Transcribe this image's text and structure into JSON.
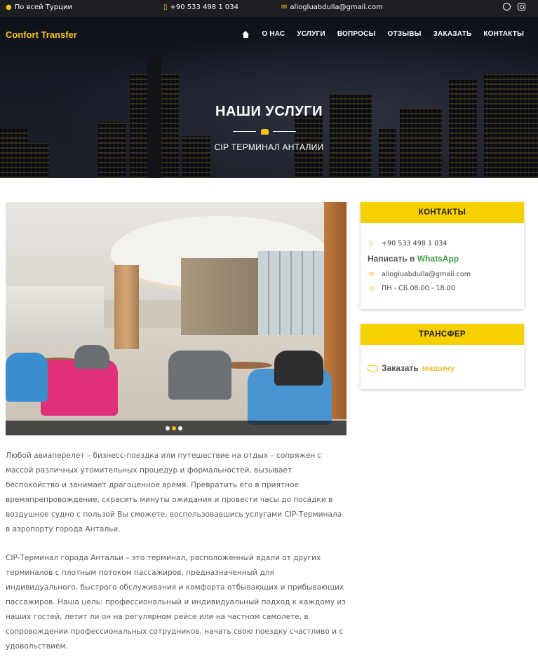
{
  "topbar": {
    "location": "По всей Турции",
    "phone": "+90 533 498 1 034",
    "email": "aliogluabdulla@gmail.com",
    "social": [
      "whatsapp-icon",
      "instagram-icon"
    ]
  },
  "header": {
    "brand": "Confort Transfer",
    "nav": [
      "О НАС",
      "УСЛУГИ",
      "ВОПРОСЫ",
      "ОТЗЫВЫ",
      "ЗАКАЗАТЬ",
      "КОНТАКТЫ"
    ]
  },
  "hero": {
    "title": "НАШИ УСЛУГИ",
    "subtitle": "CIP ТЕРМИНАЛ АНТАЛИИ"
  },
  "slider": {
    "slides": 3,
    "active": 2
  },
  "content": {
    "p1": "Любой авиаперелет – бизнесс-поездка или путешествие на отдых – сопряжен с массой различных утомительных процедур и формальностей, вызывает беспокойство и занимает драгоценное время. Превратить его в приятное времяпрепровождение, скрасить минуты ожидания и провести часы до посадки в воздушное судно с пользой Вы сможете, воспользовавшись услугами CIP-Терминала в аэропорту города Антальи.",
    "p2": "CIP-Терминал города Антальи – это терминал, расположенный вдали от других терминалов с плотным потоком пассажиров, предназначенный для индивидуального, быстрого обслуживания и комфорта отбывающих и прибывающих пассажиров. Наша цель: профессиональный и индивидуальный подход к каждому из наших гостей, летит ли он на регулярном рейсе или на частном самолете, в сопровождении профессиональных сотрудников, начать свою поездку счастливо и с удовольствием."
  },
  "contacts": {
    "title": "КОНТАКТЫ",
    "phone": "+90 533 498 1 034",
    "whatsapp_prefix": "Написать в ",
    "whatsapp_label": "WhatsApp",
    "email": "aliogluabdulla@gmail.com",
    "hours": "ПН - СБ 08.00 - 18.00"
  },
  "transfer": {
    "title": "ТРАНСФЕР",
    "order_prefix": "Заказать ",
    "order_link": "машину"
  },
  "colors": {
    "accent": "#f7d000",
    "topbar": "#1d1e22",
    "whatsapp": "#43a047"
  }
}
